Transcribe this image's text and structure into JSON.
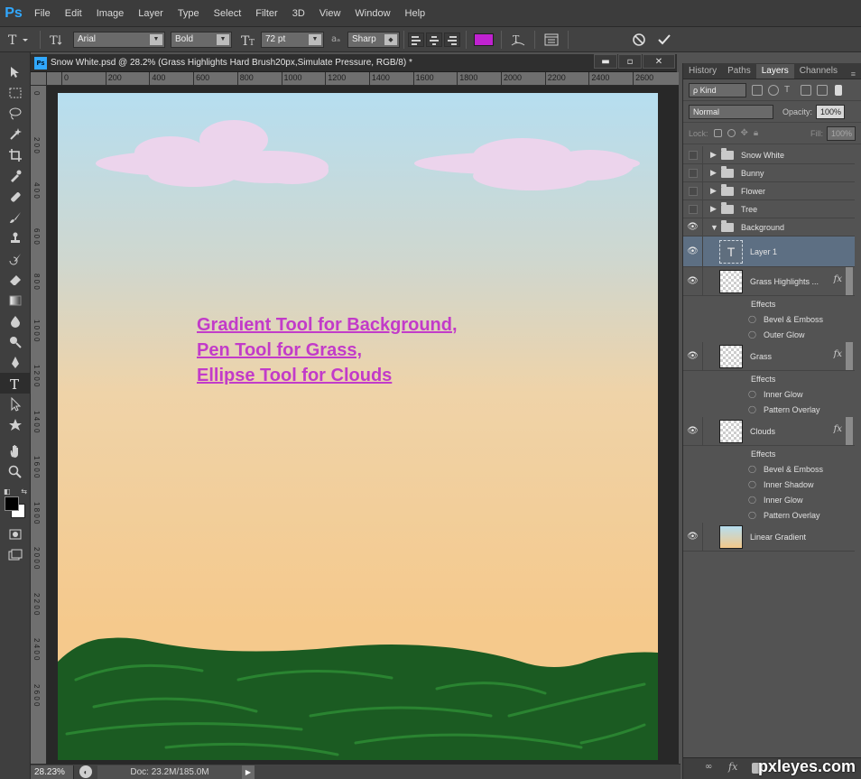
{
  "app": {
    "logo": "Ps",
    "menu": [
      "File",
      "Edit",
      "Image",
      "Layer",
      "Type",
      "Select",
      "Filter",
      "3D",
      "View",
      "Window",
      "Help"
    ]
  },
  "options": {
    "font_family": "Arial",
    "font_style": "Bold",
    "font_size": "72 pt",
    "aa_label": "aₐ",
    "antialias": "Sharp",
    "text_color": "#c022d0"
  },
  "document": {
    "title": "Snow White.psd @ 28.2% (Grass Highlights    Hard Brush20px,Simulate Pressure, RGB/8) *",
    "ruler_top": [
      "0",
      "200",
      "400",
      "600",
      "800",
      "1000",
      "1200",
      "1400",
      "1600",
      "1800",
      "2000",
      "2200",
      "2400",
      "2600"
    ],
    "ruler_left": [
      "0",
      "2 0 0",
      "4 0 0",
      "6 0 0",
      "8 0 0",
      "1 0 0 0",
      "1 2 0 0",
      "1 4 0 0",
      "1 6 0 0",
      "1 8 0 0",
      "2 0 0 0",
      "2 2 0 0",
      "2 4 0 0",
      "2 6 0 0"
    ],
    "canvas_text": [
      "Gradient Tool for Background,",
      "Pen Tool for Grass,",
      "Ellipse Tool for Clouds"
    ]
  },
  "status": {
    "zoom": "28.23%",
    "doc": "Doc: 23.2M/185.0M"
  },
  "panel": {
    "tabs": [
      "History",
      "Paths",
      "Layers",
      "Channels"
    ],
    "kind_label": "ρ Kind",
    "blend_mode": "Normal",
    "opacity_label": "Opacity:",
    "opacity_value": "100%",
    "lock_label": "Lock:",
    "fill_label": "Fill:",
    "fill_value": "100%",
    "groups": [
      "Snow White",
      "Bunny",
      "Flower",
      "Tree",
      "Background"
    ],
    "layers": {
      "layer1": "Layer 1",
      "grass_highlights": "Grass Highlights ...",
      "grass": "Grass",
      "clouds": "Clouds",
      "linear_gradient": "Linear Gradient"
    },
    "effects_label": "Effects",
    "fx_label": "fx",
    "grass_highlights_effects": [
      "Bevel & Emboss",
      "Outer Glow"
    ],
    "grass_effects": [
      "Inner Glow",
      "Pattern Overlay"
    ],
    "clouds_effects": [
      "Bevel & Emboss",
      "Inner Shadow",
      "Inner Glow",
      "Pattern Overlay"
    ]
  },
  "watermark": "pxleyes.com"
}
